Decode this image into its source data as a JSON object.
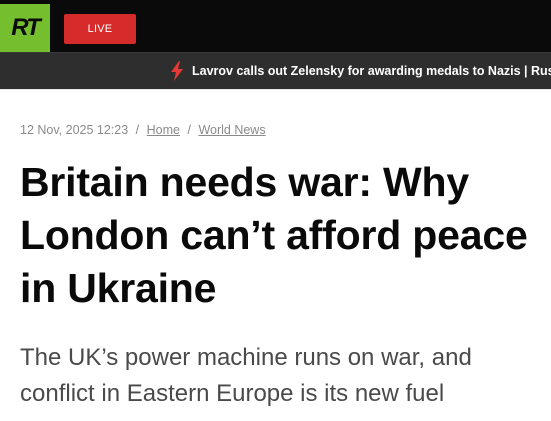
{
  "header": {
    "logo_text": "RT",
    "live_label": "LIVE",
    "colors": {
      "logo_bg": "#75bf2e",
      "live_bg": "#d52b2b",
      "topbar_bg": "#0a0a0a",
      "ticker_bg": "#2e2e2e"
    }
  },
  "ticker": {
    "icon": "lightning-bolt-icon",
    "text": "Lavrov calls out Zelensky for awarding medals to Nazis | Rus"
  },
  "article": {
    "date": "12 Nov, 2025 12:23",
    "breadcrumb": [
      "Home",
      "World News"
    ],
    "separator": "/",
    "headline": "Britain needs war: Why London can’t afford peace in Ukraine",
    "summary": "The UK’s power machine runs on war, and conflict in Eastern Europe is its new fuel"
  }
}
